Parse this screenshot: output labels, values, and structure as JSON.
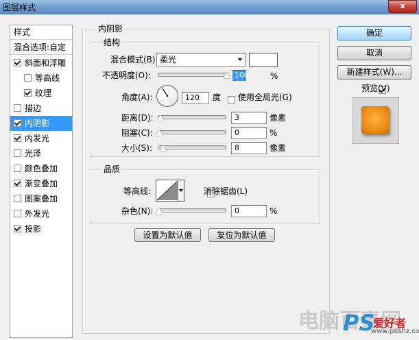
{
  "window": {
    "title": "图层样式",
    "close_label": "x"
  },
  "styles_panel": {
    "header": "样式",
    "blend_options": "混合选项:自定",
    "items": [
      {
        "label": "斜面和浮雕",
        "checked": true
      },
      {
        "label": "等高线",
        "checked": false
      },
      {
        "label": "纹理",
        "checked": true
      },
      {
        "label": "描边",
        "checked": false
      },
      {
        "label": "内阴影",
        "checked": true,
        "selected": true
      },
      {
        "label": "内发光",
        "checked": true
      },
      {
        "label": "光泽",
        "checked": false
      },
      {
        "label": "颜色叠加",
        "checked": false
      },
      {
        "label": "渐变叠加",
        "checked": true
      },
      {
        "label": "图案叠加",
        "checked": false
      },
      {
        "label": "外发光",
        "checked": false
      },
      {
        "label": "投影",
        "checked": true
      }
    ]
  },
  "inner_shadow": {
    "section_title": "内阴影",
    "structure": {
      "title": "结构",
      "blend_mode_label": "混合模式(B):",
      "blend_mode_value": "柔光",
      "shadow_color": "#ffffff",
      "opacity_label": "不透明度(O):",
      "opacity_value": "100",
      "opacity_unit": "%",
      "opacity_level": 1.0,
      "angle_label": "角度(A):",
      "angle_value": "120",
      "angle_unit": "度",
      "global_light_label": "使用全局光(G)",
      "global_light_checked": false,
      "distance_label": "距离(D):",
      "distance_value": "3",
      "distance_unit": "像素",
      "choke_label": "阻塞(C):",
      "choke_value": "0",
      "choke_unit": "%",
      "size_label": "大小(S):",
      "size_value": "8",
      "size_unit": "像素"
    },
    "quality": {
      "title": "品质",
      "contour_label": "等高线:",
      "antialias_label": "消除锯齿(L)",
      "antialias_checked": false,
      "noise_label": "杂色(N):",
      "noise_value": "0",
      "noise_unit": "%"
    },
    "make_default_label": "设置为默认值",
    "reset_default_label": "复位为默认值"
  },
  "actions": {
    "ok_label": "确定",
    "cancel_label": "取消",
    "new_style_label": "新建样式(W)...",
    "preview_label": "预览(V)",
    "preview_checked": true
  },
  "watermark": {
    "text1": "电脑百事网",
    "ps_text": "PS",
    "brand_text": "爱好者",
    "url_text": "www.psahz.com"
  }
}
